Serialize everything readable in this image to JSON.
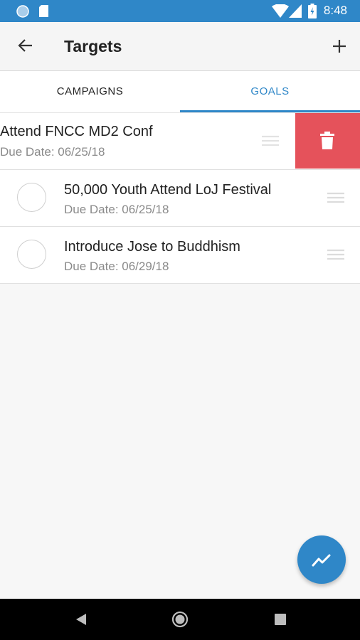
{
  "status_bar": {
    "time": "8:48"
  },
  "app_bar": {
    "title": "Targets",
    "back_icon": "arrow-back-icon",
    "add_icon": "plus-icon"
  },
  "tabs": [
    {
      "label": "CAMPAIGNS",
      "active": false
    },
    {
      "label": "GOALS",
      "active": true
    }
  ],
  "goals": [
    {
      "title": "Attend FNCC MD2 Conf",
      "due": "Due Date: 06/25/18",
      "swiped": true,
      "action": "delete"
    },
    {
      "title": "50,000 Youth Attend LoJ Festival",
      "due": "Due Date: 06/25/18"
    },
    {
      "title": "Introduce Jose to Buddhism",
      "due": "Due Date: 06/29/18"
    }
  ],
  "fab": {
    "icon": "trending-up-icon"
  },
  "colors": {
    "primary": "#2f87c8",
    "delete": "#e5525b",
    "background": "#f7f7f7"
  }
}
